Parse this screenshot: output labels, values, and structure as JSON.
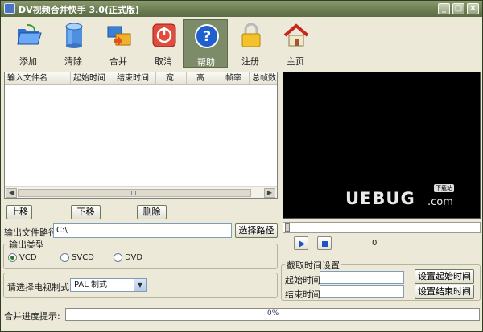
{
  "window": {
    "title": "DV视频合并快手 3.0(正式版)"
  },
  "toolbar": [
    {
      "id": "add",
      "label": "添加",
      "icon": "folder-open-icon"
    },
    {
      "id": "clear",
      "label": "清除",
      "icon": "database-cylinder-icon"
    },
    {
      "id": "merge",
      "label": "合并",
      "icon": "folders-merge-icon"
    },
    {
      "id": "cancel",
      "label": "取消",
      "icon": "power-stop-icon"
    },
    {
      "id": "help",
      "label": "帮助",
      "icon": "question-mark-icon"
    },
    {
      "id": "register",
      "label": "注册",
      "icon": "padlock-icon"
    },
    {
      "id": "home",
      "label": "主页",
      "icon": "house-icon"
    }
  ],
  "file_list": {
    "columns": [
      "输入文件名",
      "起始时间",
      "结束时间",
      "宽",
      "高",
      "帧率",
      "总帧数"
    ]
  },
  "list_buttons": {
    "move_up": "上移",
    "move_down": "下移",
    "delete": "删除"
  },
  "output": {
    "path_label": "输出文件路径:",
    "path_value": "C:\\",
    "browse_label": "选择路径"
  },
  "output_type": {
    "title": "输出类型",
    "options": [
      "VCD",
      "SVCD",
      "DVD"
    ],
    "selected": "VCD"
  },
  "tv_system": {
    "label": "请选择电视制式:",
    "value": "PAL 制式"
  },
  "capture": {
    "title": "截取时间设置",
    "start_label": "起始时间:",
    "end_label": "结束时间:",
    "start_value": "",
    "end_value": "",
    "set_start_label": "设置起始时间",
    "set_end_label": "设置结束时间"
  },
  "preview": {
    "watermark": "UEBUG",
    "watermark_suffix": ".com",
    "watermark_tag": "下载站",
    "time_value": "0"
  },
  "status": {
    "label": "合并进度提示:",
    "progress": 0,
    "progress_text": "0%"
  },
  "colors": {
    "titlebar": "#6b7b50",
    "active_tool": "#7d8c68",
    "background": "#ece9d8",
    "progress": "#3a8a2c"
  }
}
